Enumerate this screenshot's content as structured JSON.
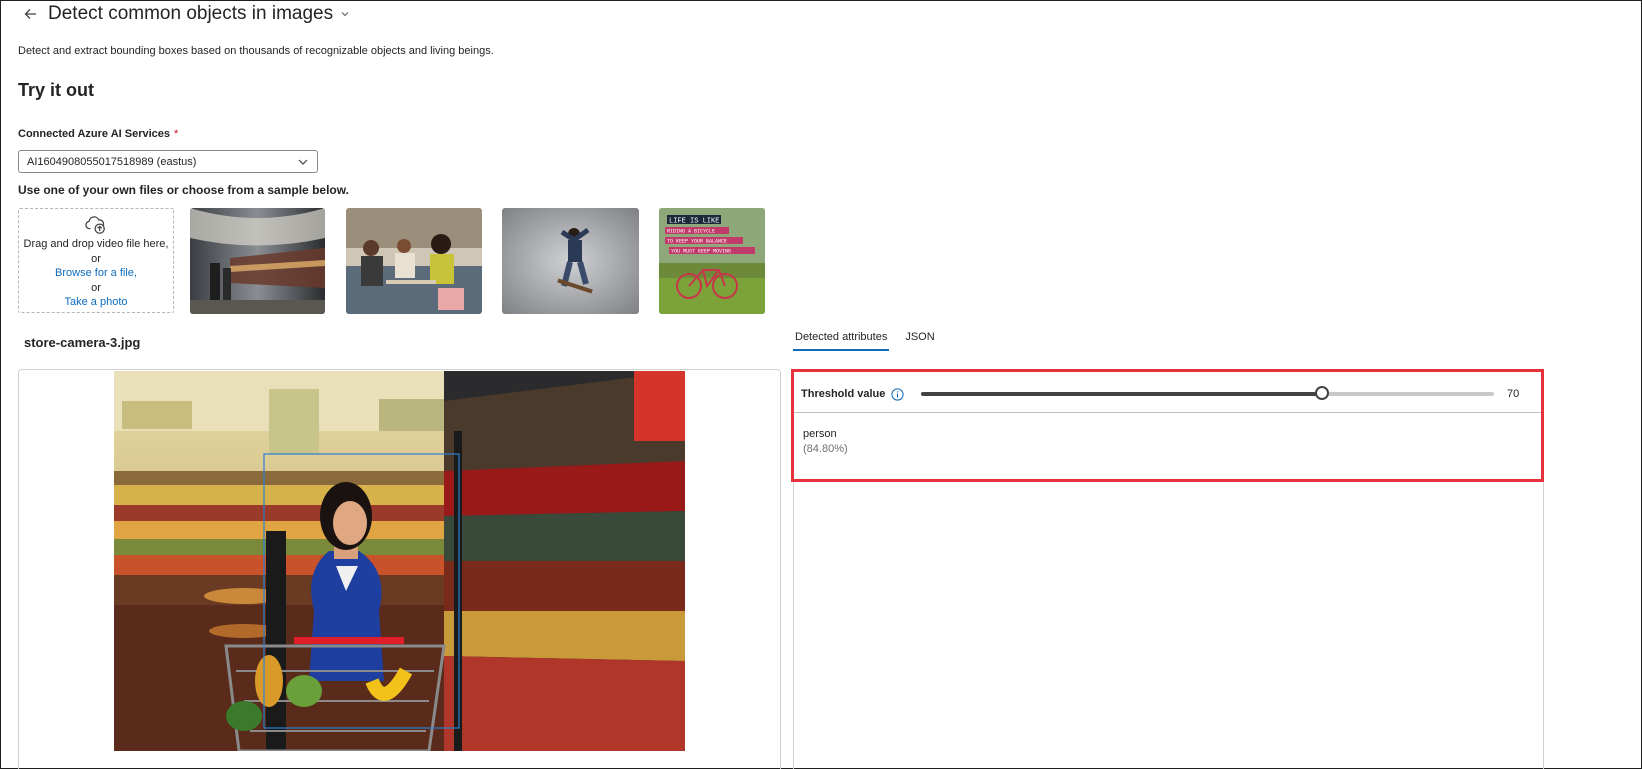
{
  "header": {
    "title": "Detect common objects in images"
  },
  "description": "Detect and extract bounding boxes based on thousands of recognizable objects and living beings.",
  "section_title": "Try it out",
  "connection": {
    "label": "Connected Azure AI Services",
    "required_mark": "*",
    "selected": "AI1604908055017518989 (eastus)"
  },
  "instructions": "Use one of your own files or choose from a sample below.",
  "dropzone": {
    "text": "Drag and drop video file here,",
    "or_1": "or",
    "browse": "Browse for a file,",
    "or_2": "or",
    "take_photo": "Take a photo"
  },
  "sample_poster_text": [
    "LIFE IS LIKE",
    "RIDING A BICYCLE",
    "TO KEEP YOUR BALANCE",
    "YOU MUST KEEP MOVING"
  ],
  "filename": "store-camera-3.jpg",
  "tabs": [
    {
      "label": "Detected attributes",
      "active": true
    },
    {
      "label": "JSON",
      "active": false
    }
  ],
  "threshold": {
    "label": "Threshold value",
    "value": 70,
    "value_text": "70"
  },
  "detections": [
    {
      "name": "person",
      "confidence": "(84.80%)"
    }
  ],
  "colors": {
    "accent": "#0f6cbd",
    "highlight": "#e5323b",
    "required": "#c50f1f"
  }
}
